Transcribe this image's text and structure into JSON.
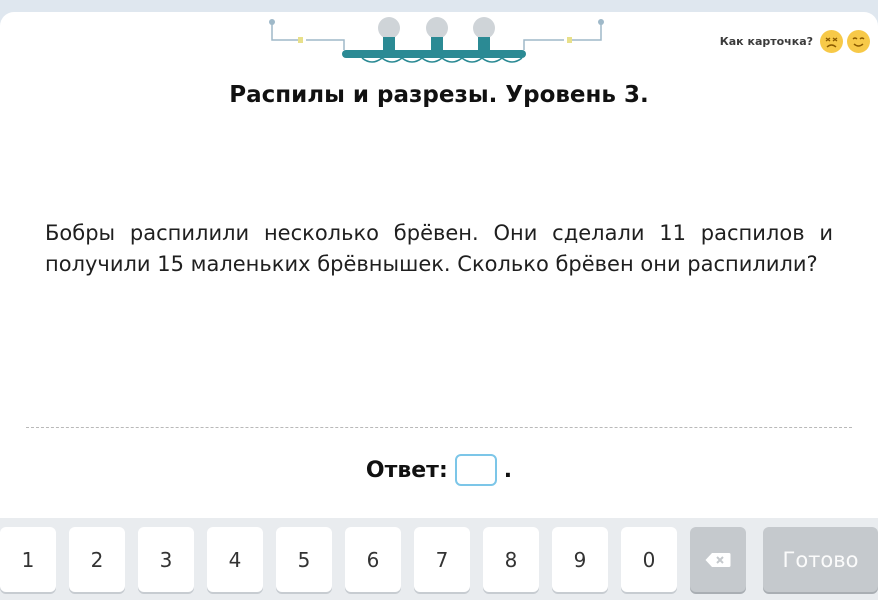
{
  "header": {
    "rating_label": "Как карточка?",
    "rating_icons": [
      "dislike-face-icon",
      "like-face-icon"
    ]
  },
  "title": "Распилы и разрезы. Уровень 3.",
  "problem": "Бобры распилили несколько брёвен. Они сделали 11 распилов и получили 15 маленьких брёвнышек. Сколько брёвен они распилили?",
  "answer": {
    "label": "Ответ:",
    "value": "",
    "suffix": "."
  },
  "keypad": {
    "keys": [
      "1",
      "2",
      "3",
      "4",
      "5",
      "6",
      "7",
      "8",
      "9",
      "0"
    ],
    "backspace_icon": "backspace-icon",
    "done_label": "Готово"
  },
  "colors": {
    "accent": "#7cc6e8",
    "bar": "#2b8a94",
    "emoji": "#f7c948"
  }
}
